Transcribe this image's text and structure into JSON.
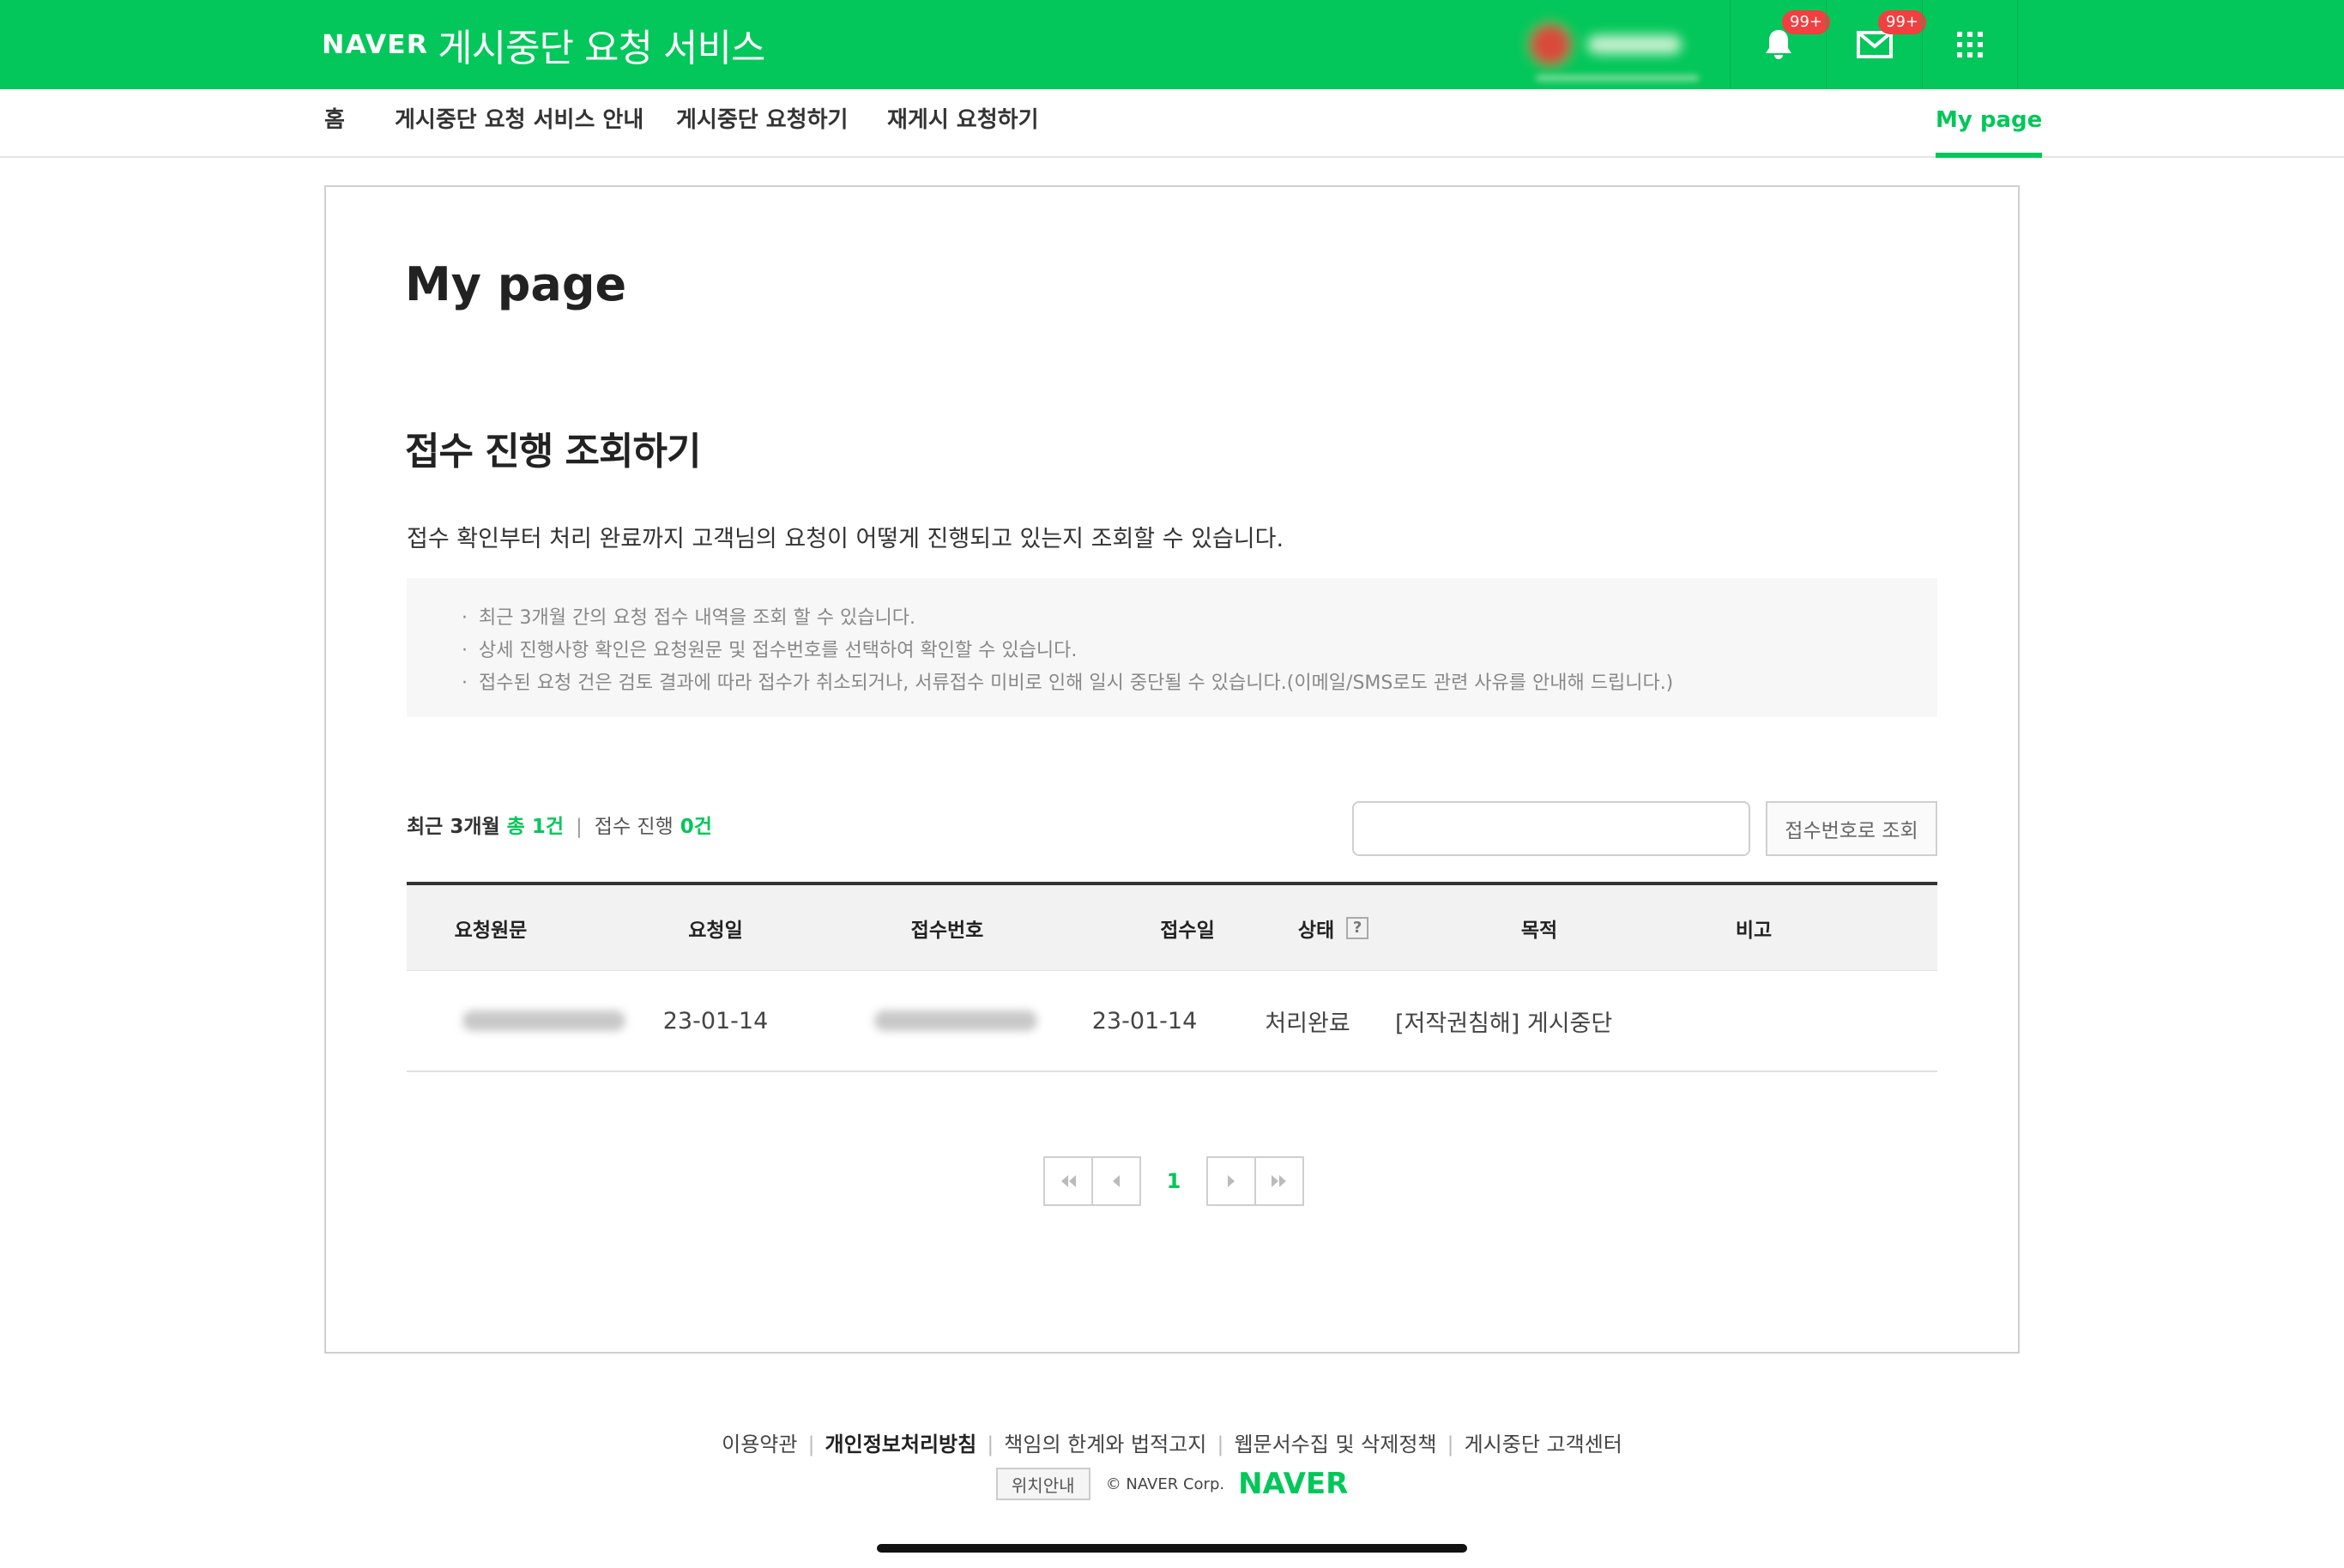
{
  "header": {
    "logo": "NAVER",
    "title": "게시중단 요청 서비스",
    "notifications_badge": "99+",
    "mail_badge": "99+",
    "colors": {
      "brand": "#03c75a",
      "badge": "#f23f3f"
    }
  },
  "nav": {
    "items": [
      {
        "label": "홈"
      },
      {
        "label": "게시중단 요청 서비스 안내"
      },
      {
        "label": "게시중단 요청하기"
      },
      {
        "label": "재게시 요청하기"
      }
    ],
    "mypage": "My page"
  },
  "main": {
    "page_title": "My page",
    "section_title": "접수 진행 조회하기",
    "section_desc": "접수 확인부터 처리 완료까지 고객님의 요청이 어떻게 진행되고 있는지 조회할 수 있습니다.",
    "notices": [
      "최근 3개월 간의 요청 접수 내역을 조회 할 수 있습니다.",
      "상세 진행사항 확인은 요청원문 및 접수번호를 선택하여 확인할 수 있습니다.",
      "접수된 요청 건은 검토 결과에 따라 접수가 취소되거나, 서류접수 미비로 인해 일시 중단될 수 있습니다.(이메일/SMS로도 관련 사유를 안내해 드립니다.)"
    ],
    "summary": {
      "period": "최근 3개월",
      "total": "총 1건",
      "in_progress_label": "접수 진행",
      "in_progress": "0건"
    },
    "search": {
      "placeholder": "",
      "value": "",
      "button": "접수번호로 조회"
    },
    "table": {
      "headers": [
        "요청원문",
        "요청일",
        "접수번호",
        "접수일",
        "상태",
        "목적",
        "비고"
      ],
      "help_icon": "?",
      "rows": [
        {
          "request_date": "23-01-14",
          "receipt_date": "23-01-14",
          "status": "처리완료",
          "purpose": "[저작권침해] 게시중단",
          "note": ""
        }
      ]
    },
    "pagination": {
      "current": "1"
    }
  },
  "footer": {
    "links": [
      "이용약관",
      "개인정보처리방침",
      "책임의 한계와 법적고지",
      "웹문서수집 및 삭제정책",
      "게시중단 고객센터"
    ],
    "location_button": "위치안내",
    "copyright": "© NAVER Corp.",
    "logo": "NAVER"
  }
}
